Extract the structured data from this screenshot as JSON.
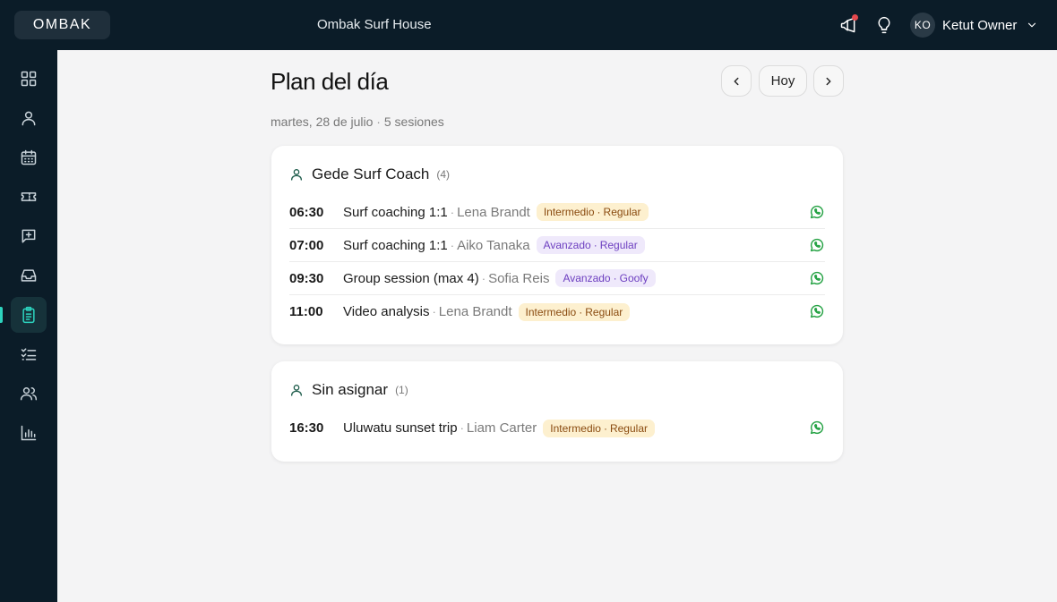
{
  "header": {
    "logo": "OMBAK",
    "site_name": "Ombak Surf House",
    "user_initials": "KO",
    "user_name": "Ketut Owner"
  },
  "icons": {
    "notifications": "megaphone-icon",
    "tips": "lightbulb-icon",
    "whatsapp": "whatsapp-icon"
  },
  "sidebar": {
    "items": [
      {
        "icon": "dashboard-icon",
        "active": false
      },
      {
        "icon": "user-icon",
        "active": false
      },
      {
        "icon": "calendar-icon",
        "active": false
      },
      {
        "icon": "ticket-icon",
        "active": false
      },
      {
        "icon": "message-plus-icon",
        "active": false
      },
      {
        "icon": "inbox-icon",
        "active": false
      },
      {
        "icon": "clipboard-icon",
        "active": true
      },
      {
        "icon": "checklist-icon",
        "active": false
      },
      {
        "icon": "users-icon",
        "active": false
      },
      {
        "icon": "bar-chart-icon",
        "active": false
      }
    ]
  },
  "page": {
    "title": "Plan del día",
    "date": "martes, 28 de julio",
    "sessions": "5 sesiones",
    "today_label": "Hoy"
  },
  "groups": [
    {
      "title": "Gede Surf Coach",
      "count": "(4)",
      "rows": [
        {
          "time": "06:30",
          "service": "Surf coaching 1:1",
          "client": "Lena Brandt",
          "level": "Intermedio",
          "stance": "Regular",
          "tone": "amber"
        },
        {
          "time": "07:00",
          "service": "Surf coaching 1:1",
          "client": "Aiko Tanaka",
          "level": "Avanzado",
          "stance": "Regular",
          "tone": "purple"
        },
        {
          "time": "09:30",
          "service": "Group session (max 4)",
          "client": "Sofia Reis",
          "level": "Avanzado",
          "stance": "Goofy",
          "tone": "purple"
        },
        {
          "time": "11:00",
          "service": "Video analysis",
          "client": "Lena Brandt",
          "level": "Intermedio",
          "stance": "Regular",
          "tone": "amber"
        }
      ]
    },
    {
      "title": "Sin asignar",
      "count": "(1)",
      "rows": [
        {
          "time": "16:30",
          "service": "Uluwatu sunset trip",
          "client": "Liam Carter",
          "level": "Intermedio",
          "stance": "Regular",
          "tone": "amber"
        }
      ]
    }
  ],
  "colors": {
    "topbar": "#0b1c28",
    "accent": "#2dd4bf",
    "whatsapp": "#25a244",
    "badge_amber": "#fdf0cf",
    "badge_purple": "#efe9fb"
  }
}
